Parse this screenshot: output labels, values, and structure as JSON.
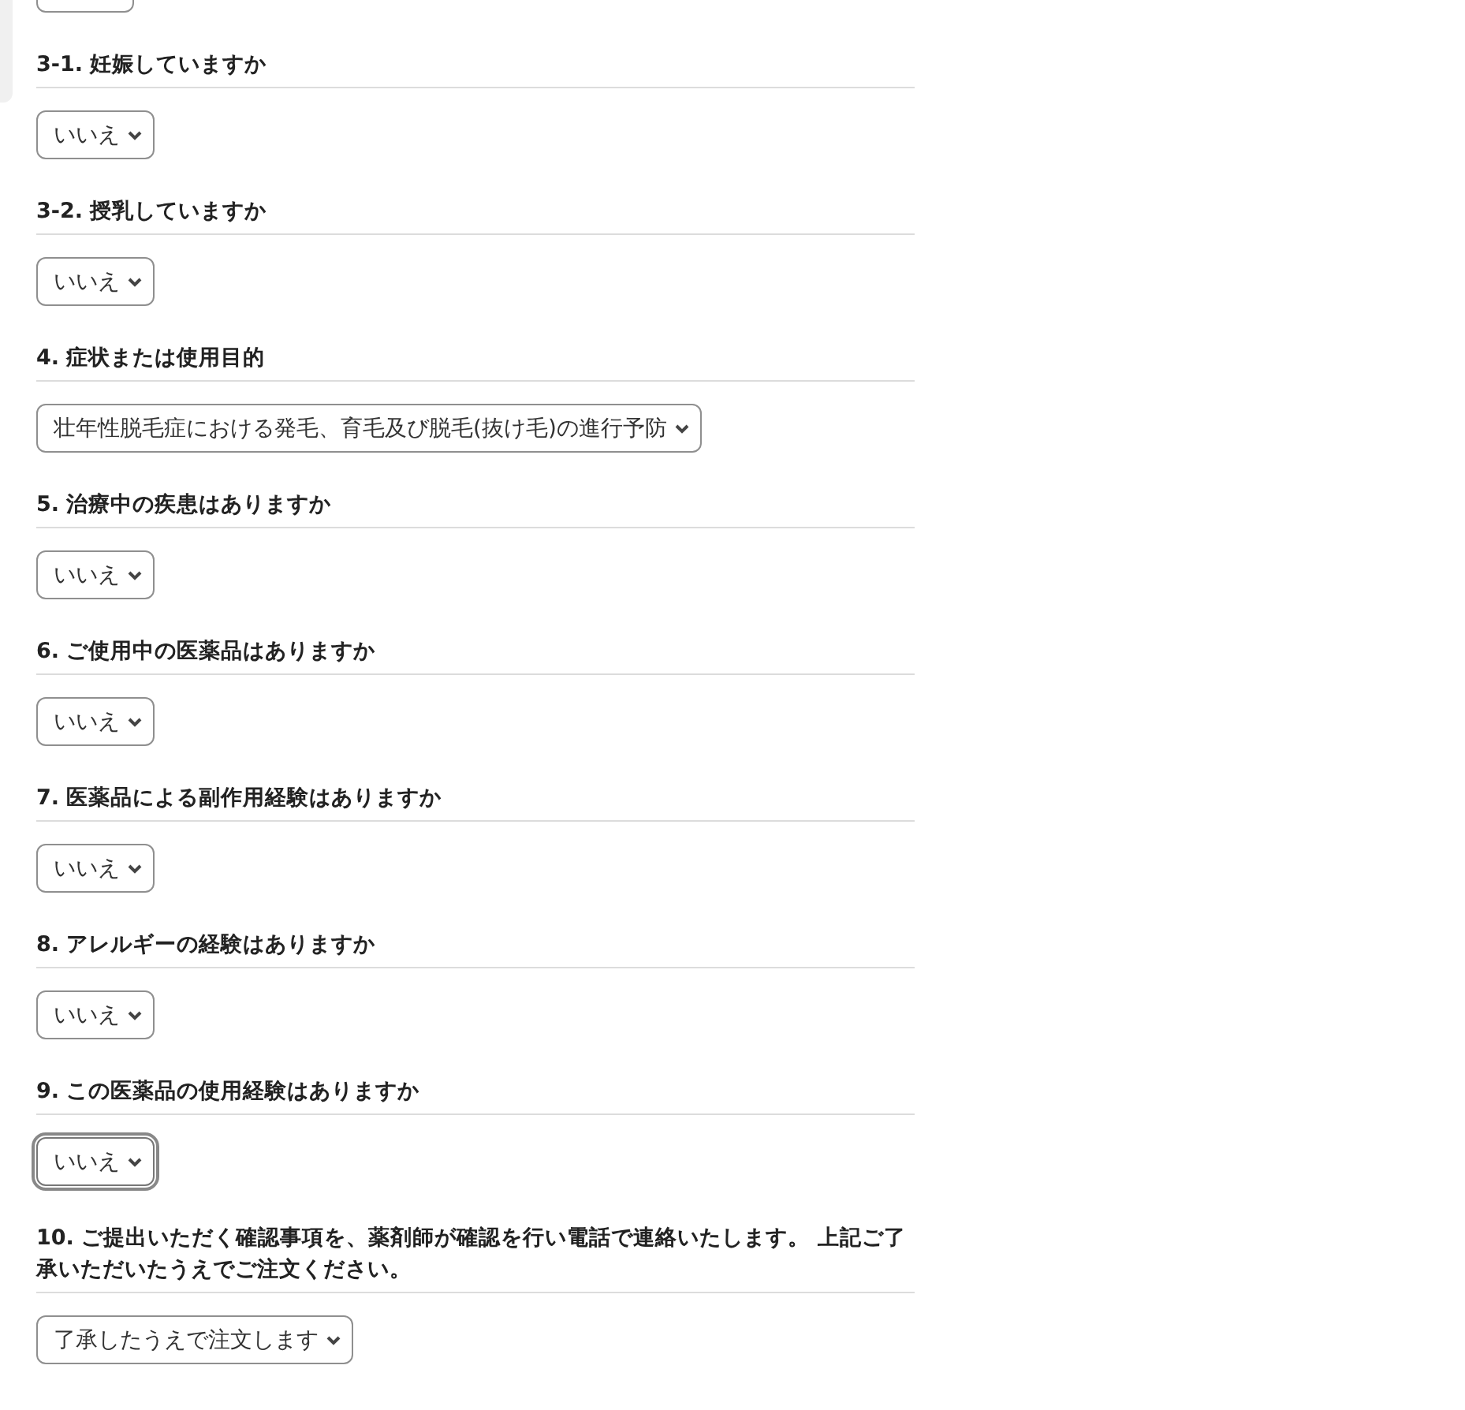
{
  "questions": [
    {
      "label": "3-1. 妊娠していますか",
      "answer": "いいえ",
      "focused": false
    },
    {
      "label": "3-2. 授乳していますか",
      "answer": "いいえ",
      "focused": false
    },
    {
      "label": "4. 症状または使用目的",
      "answer": "壮年性脱毛症における発毛、育毛及び脱毛(抜け毛)の進行予防",
      "focused": false
    },
    {
      "label": "5. 治療中の疾患はありますか",
      "answer": "いいえ",
      "focused": false
    },
    {
      "label": "6. ご使用中の医薬品はありますか",
      "answer": "いいえ",
      "focused": false
    },
    {
      "label": "7. 医薬品による副作用経験はありますか",
      "answer": "いいえ",
      "focused": false
    },
    {
      "label": "8. アレルギーの経験はありますか",
      "answer": "いいえ",
      "focused": false
    },
    {
      "label": "9. この医薬品の使用経験はありますか",
      "answer": "いいえ",
      "focused": true
    },
    {
      "label": "10. ご提出いただく確認事項を、薬剤師が確認を行い電話で連絡いたします。 上記ご了承いただいたうえでご注文ください。",
      "answer": "了承したうえで注文します",
      "focused": false
    }
  ]
}
